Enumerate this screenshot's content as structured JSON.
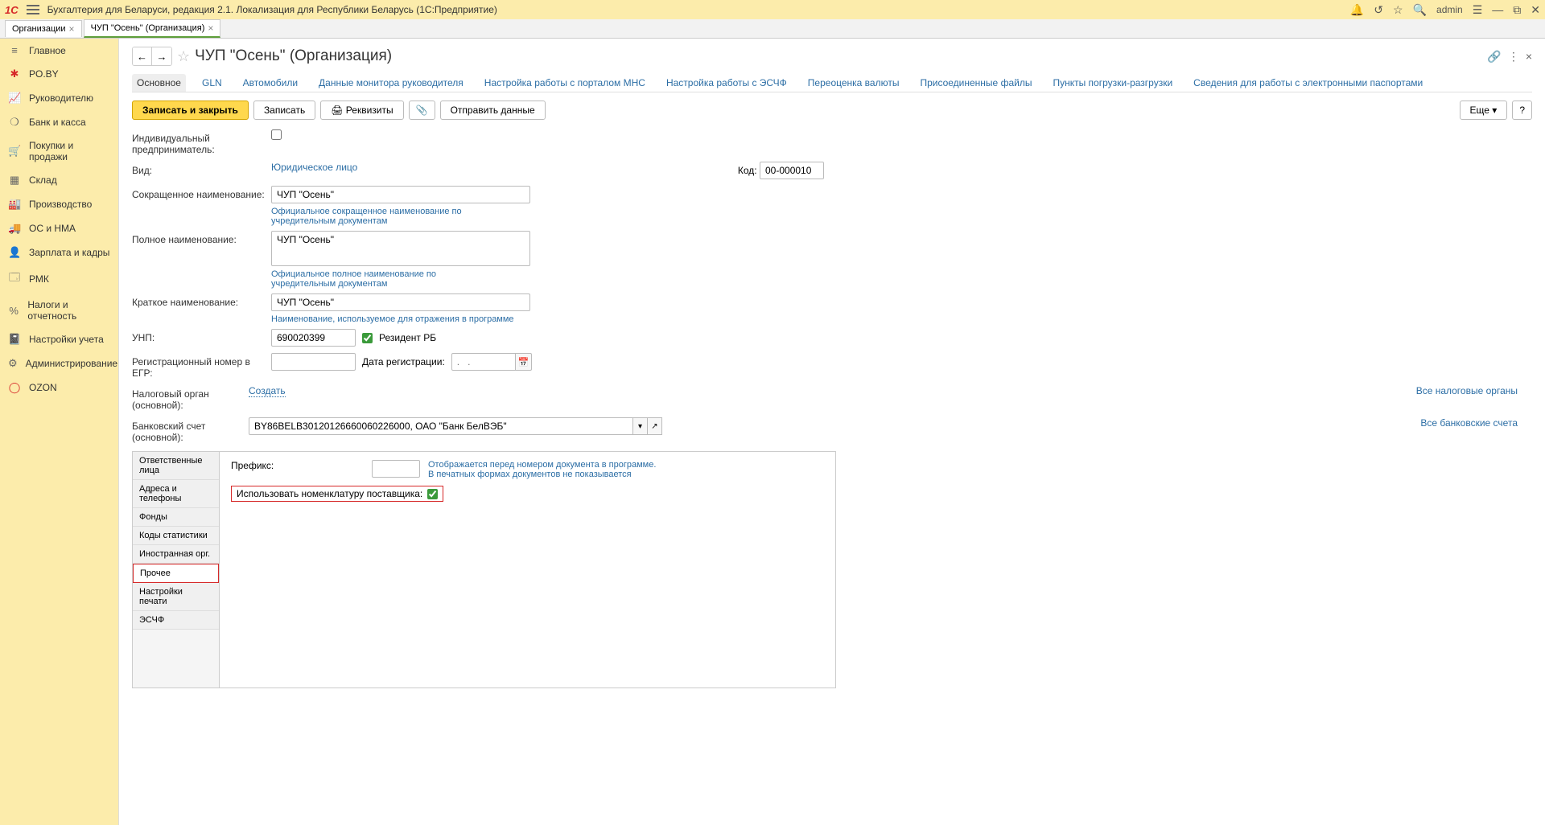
{
  "titlebar": {
    "app_title": "Бухгалтерия для Беларуси, редакция 2.1. Локализация для Республики Беларусь   (1С:Предприятие)",
    "user": "admin"
  },
  "tabs": [
    {
      "label": "Организации"
    },
    {
      "label": "ЧУП \"Осень\" (Организация)",
      "active": true
    }
  ],
  "sidebar": [
    {
      "icon": "≡",
      "label": "Главное",
      "cls": "ic-gray"
    },
    {
      "icon": "✱",
      "label": "PO.BY",
      "cls": "ic-red"
    },
    {
      "icon": "📈",
      "label": "Руководителю",
      "cls": "ic-gray"
    },
    {
      "icon": "❍",
      "label": "Банк и касса",
      "cls": "ic-gray"
    },
    {
      "icon": "🛒",
      "label": "Покупки и продажи",
      "cls": "ic-gray"
    },
    {
      "icon": "▦",
      "label": "Склад",
      "cls": "ic-gray"
    },
    {
      "icon": "🏭",
      "label": "Производство",
      "cls": "ic-gray"
    },
    {
      "icon": "🚚",
      "label": "ОС и НМА",
      "cls": "ic-gray"
    },
    {
      "icon": "👤",
      "label": "Зарплата и кадры",
      "cls": "ic-gray"
    },
    {
      "icon": "🗔",
      "label": "РМК",
      "cls": "ic-gray"
    },
    {
      "icon": "%",
      "label": "Налоги и отчетность",
      "cls": "ic-gray"
    },
    {
      "icon": "📓",
      "label": "Настройки учета",
      "cls": "ic-gray"
    },
    {
      "icon": "⚙",
      "label": "Администрирование",
      "cls": "ic-gray"
    },
    {
      "icon": "◯",
      "label": "OZON",
      "cls": "ic-red"
    }
  ],
  "page": {
    "title": "ЧУП \"Осень\" (Организация)"
  },
  "section_tabs": [
    "Основное",
    "GLN",
    "Автомобили",
    "Данные монитора руководителя",
    "Настройка работы с порталом МНС",
    "Настройка работы с ЭСЧФ",
    "Переоценка валюты",
    "Присоединенные файлы",
    "Пункты погрузки-разгрузки",
    "Сведения для работы с электронными паспортами"
  ],
  "toolbar": {
    "save_close": "Записать и закрыть",
    "save": "Записать",
    "requisites": "Реквизиты",
    "send_data": "Отправить данные",
    "more": "Еще"
  },
  "form": {
    "ip_label": "Индивидуальный предприниматель:",
    "vid_label": "Вид:",
    "vid_value": "Юридическое лицо",
    "kod_label": "Код:",
    "kod_value": "00-000010",
    "short_name_label": "Сокращенное наименование:",
    "short_name_value": "ЧУП \"Осень\"",
    "short_hint": "Официальное сокращенное наименование по учредительным документам",
    "full_name_label": "Полное наименование:",
    "full_name_value": "ЧУП \"Осень\"",
    "full_hint": "Официальное полное наименование по учредительным документам",
    "brief_name_label": "Краткое наименование:",
    "brief_name_value": "ЧУП \"Осень\"",
    "brief_hint": "Наименование, используемое для отражения в программе",
    "unp_label": "УНП:",
    "unp_value": "690020399",
    "resident_label": "Резидент РБ",
    "egr_label": "Регистрационный номер в ЕГР:",
    "reg_date_label": "Дата регистрации:",
    "reg_date_placeholder": ".   .",
    "tax_label": "Налоговый орган (основной):",
    "tax_link": "Создать",
    "tax_all": "Все налоговые органы",
    "bank_label": "Банковский счет (основной):",
    "bank_value": "BY86BELB30120126660060226000, ОАО \"Банк БелВЭБ\"",
    "bank_all": "Все банковские счета"
  },
  "vtabs": [
    "Ответственные лица",
    "Адреса и телефоны",
    "Фонды",
    "Коды статистики",
    "Иностранная орг.",
    "Прочее",
    "Настройки печати",
    "ЭСЧФ"
  ],
  "prochee": {
    "prefix_label": "Префикс:",
    "prefix_hint1": "Отображается перед номером документа в программе.",
    "prefix_hint2": "В печатных формах документов не показывается",
    "use_nomen_label": "Использовать номенклатуру поставщика:"
  }
}
